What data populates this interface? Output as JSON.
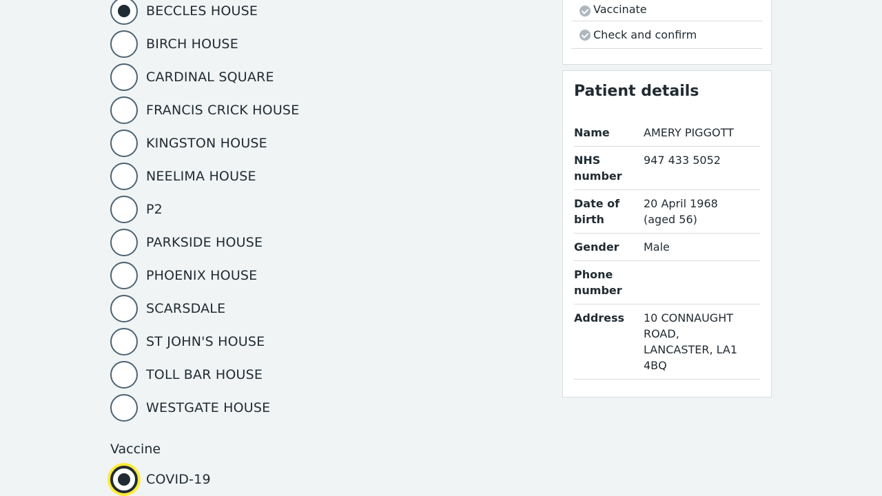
{
  "locations": {
    "items": [
      {
        "label": "BECCLES HOUSE",
        "checked": true
      },
      {
        "label": "BIRCH HOUSE",
        "checked": false
      },
      {
        "label": "CARDINAL SQUARE",
        "checked": false
      },
      {
        "label": "FRANCIS CRICK HOUSE",
        "checked": false
      },
      {
        "label": "KINGSTON HOUSE",
        "checked": false
      },
      {
        "label": "NEELIMA HOUSE",
        "checked": false
      },
      {
        "label": "P2",
        "checked": false
      },
      {
        "label": "PARKSIDE HOUSE",
        "checked": false
      },
      {
        "label": "PHOENIX HOUSE",
        "checked": false
      },
      {
        "label": "SCARSDALE",
        "checked": false
      },
      {
        "label": "ST JOHN'S HOUSE",
        "checked": false
      },
      {
        "label": "TOLL BAR HOUSE",
        "checked": false
      },
      {
        "label": "WESTGATE HOUSE",
        "checked": false
      }
    ]
  },
  "vaccine": {
    "label": "Vaccine",
    "items": [
      {
        "label": "COVID-19",
        "checked": true
      }
    ]
  },
  "tasks": {
    "items": [
      {
        "label": "Vaccinate",
        "icon": "check-circle-icon"
      },
      {
        "label": "Check and confirm",
        "icon": "check-circle-icon"
      }
    ]
  },
  "patient": {
    "title": "Patient details",
    "rows": [
      {
        "key": "Name",
        "value": "AMERY PIGGOTT"
      },
      {
        "key": "NHS number",
        "value": "947 433 5052"
      },
      {
        "key": "Date of birth",
        "value": "20 April 1968\n(aged 56)"
      },
      {
        "key": "Gender",
        "value": "Male"
      },
      {
        "key": "Phone number",
        "value": ""
      },
      {
        "key": "Address",
        "value": "10 CONNAUGHT ROAD, LANCASTER, LA1 4BQ"
      }
    ]
  },
  "colors": {
    "background": "#f0f4f5",
    "text": "#212b32",
    "radio_border": "#4c6272",
    "focus": "#ffeb3b",
    "done_icon": "#aeb7bd"
  }
}
